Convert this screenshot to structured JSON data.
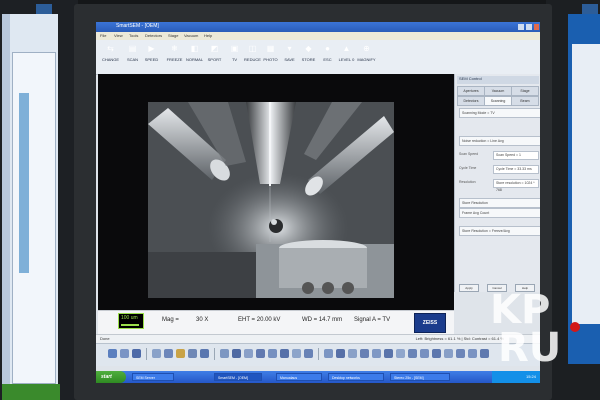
{
  "app": {
    "title": "SmartSEM - [OEM]",
    "menu": [
      "File",
      "View",
      "Tools",
      "Detectors",
      "Stage",
      "Vacuum",
      "Help"
    ]
  },
  "toolbar": [
    {
      "label": "CHANGE",
      "icon": "change-icon",
      "color": "#3a6fd0"
    },
    {
      "label": "SCAN",
      "icon": "scan-icon",
      "color": "#2f85c8"
    },
    {
      "label": "SPEED",
      "icon": "speed-icon",
      "color": "#5b6fd4"
    },
    {
      "label": "FREEZE",
      "icon": "freeze-icon",
      "color": "#3b9ad6"
    },
    {
      "label": "NORMAL",
      "icon": "normal-icon",
      "color": "#4467cf"
    },
    {
      "label": "SPORT",
      "icon": "sport-icon",
      "color": "#3168b8"
    },
    {
      "label": "TV",
      "icon": "tv-icon",
      "color": "#6a7fb0"
    },
    {
      "label": "REDUCE",
      "icon": "reduce-icon",
      "color": "#d35b5b"
    },
    {
      "label": "PHOTO",
      "icon": "photo-icon",
      "color": "#7b8799"
    },
    {
      "label": "SAVE",
      "icon": "save-icon",
      "color": "#4b6cc2"
    },
    {
      "label": "STORE",
      "icon": "store-icon",
      "color": "#d9872a"
    },
    {
      "label": "ESC",
      "icon": "esc-icon",
      "color": "#d86a2a"
    },
    {
      "label": "LEVEL 0",
      "icon": "level-icon",
      "color": "#c43c3c"
    },
    {
      "label": "MAGNIFY",
      "icon": "magnify-icon",
      "color": "#4a78c8"
    }
  ],
  "databar": {
    "scale_label": "100 um",
    "mag_label": "Mag =",
    "mag_value": "30 X",
    "eht": "EHT = 20.00 kV",
    "wd": "WD = 14.7 mm",
    "signal": "Signal A = TV",
    "logo": "ZEISS"
  },
  "panel": {
    "header": "SEM Control",
    "tabs": [
      "Apertures",
      "Vacuum",
      "Stage"
    ],
    "tabs2": [
      "Detectors",
      "Scanning",
      "Beam"
    ],
    "rows": [
      "Scanning Mode = TV",
      "Noise reduction = Line Avg"
    ],
    "labels": [
      "Scan Speed",
      "Cycle Time",
      "Resolution"
    ],
    "values": [
      "Scan Speed = 1",
      "Cycle Time = 33.33 ms",
      "Store resolution = 1024 * 768"
    ],
    "rows2": [
      "Store Resolution",
      "Frame Avg Count",
      "Store Resolution = Freeze/Avg"
    ],
    "buttons": [
      "Apply",
      "Cancel",
      "Help"
    ]
  },
  "status": {
    "left": "Done",
    "right": "Left: Brightness = 61.1 % | Std: Contrast = 61.4 %"
  },
  "taskbar": {
    "start": "start",
    "items": [
      "SEM Server",
      "SmartSEM - [OEM]",
      "Manualaus",
      "Desktop networks",
      "Stereo 25x - [SEM]"
    ],
    "time": "15:24"
  },
  "watermark": {
    "line1": "KP",
    "line2": "RU"
  }
}
